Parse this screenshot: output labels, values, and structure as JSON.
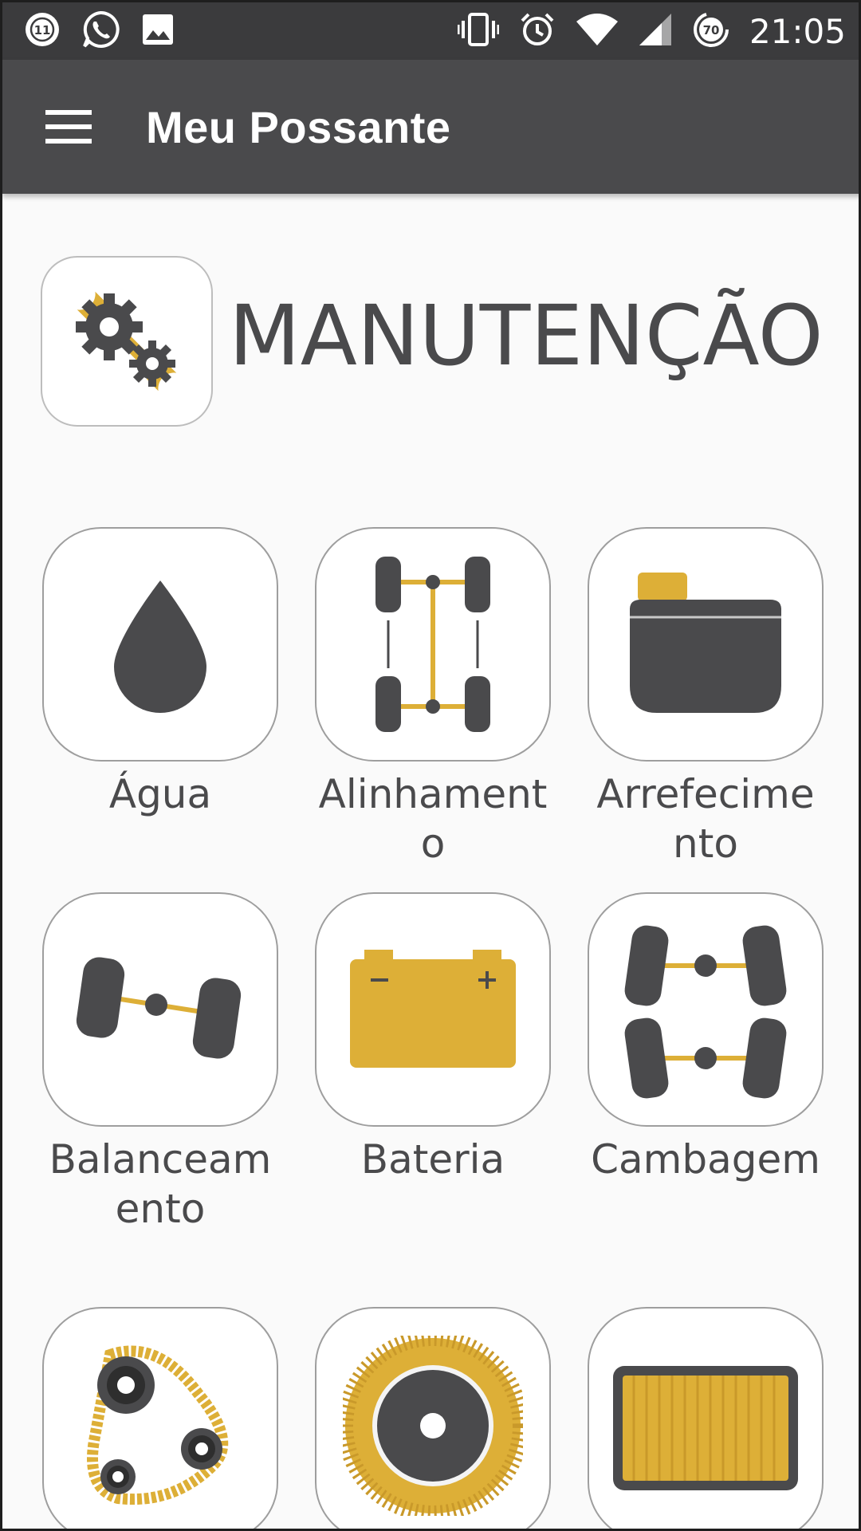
{
  "status_bar": {
    "notification_count": "11",
    "battery_level": "70",
    "time": "21:05"
  },
  "app_bar": {
    "title": "Meu Possante",
    "menu_icon": "hamburger-menu-icon"
  },
  "section": {
    "title": "MANUTENÇÃO",
    "icon": "gears-wrench-icon"
  },
  "grid": {
    "items": [
      {
        "label": "Água",
        "icon": "water-drop-icon"
      },
      {
        "label": "Alinhamento",
        "icon": "wheel-alignment-icon"
      },
      {
        "label": "Arrefecimento",
        "icon": "coolant-reservoir-icon"
      },
      {
        "label": "Balanceamento",
        "icon": "wheel-balancing-icon"
      },
      {
        "label": "Bateria",
        "icon": "car-battery-icon"
      },
      {
        "label": "Cambagem",
        "icon": "camber-icon"
      },
      {
        "label": "",
        "icon": "timing-belt-icon"
      },
      {
        "label": "",
        "icon": "brake-disc-icon"
      },
      {
        "label": "",
        "icon": "air-filter-icon"
      }
    ]
  },
  "colors": {
    "accent": "#ddaf37",
    "icon_dark": "#4a4a4c",
    "status_bar": "#3b3b3d",
    "app_bar": "#4a4a4c",
    "background": "#fafafa"
  }
}
